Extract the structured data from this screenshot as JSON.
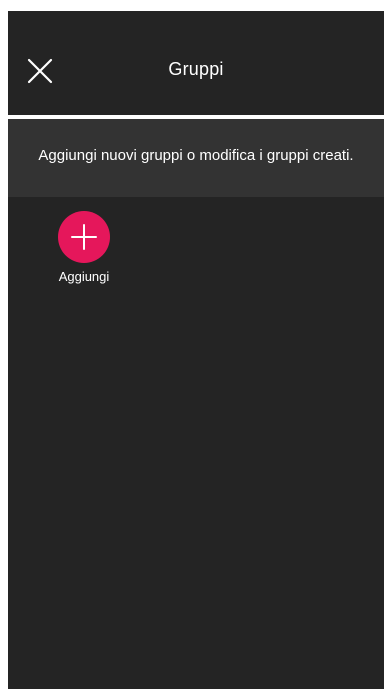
{
  "header": {
    "title": "Gruppi",
    "close_icon": "close-icon"
  },
  "banner": {
    "text": "Aggiungi nuovi gruppi o modifica i gruppi creati."
  },
  "groups": {
    "add_label": "Aggiungi",
    "add_icon": "plus-icon"
  },
  "colors": {
    "background": "#242424",
    "banner": "#333333",
    "accent": "#e5175b",
    "text": "#ffffff"
  }
}
